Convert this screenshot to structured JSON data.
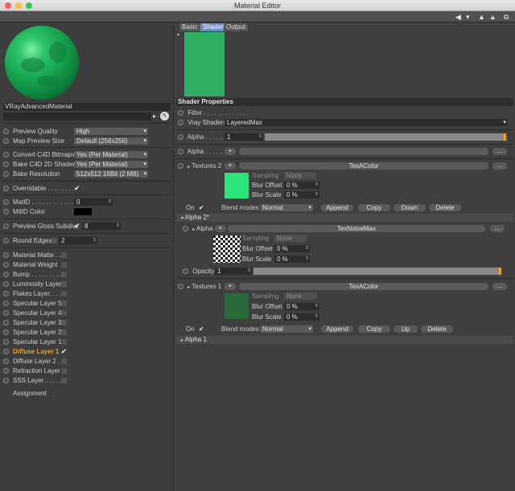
{
  "window": {
    "title": "Material Editor"
  },
  "colors": {
    "diffuse_highlight": "#f0a020",
    "preview_green": "#2fae63",
    "bright_green": "#2ee37a",
    "dark_green": "#2a6a3a"
  },
  "left": {
    "material_name": "VRayAdvancedMaterial",
    "settings": [
      {
        "label": "Preview Quality",
        "value": "High"
      },
      {
        "label": "Map Preview Size",
        "value": "Default (256x256)"
      },
      {
        "label": "Convert C4D Bitmaps",
        "value": "Yes (Per Material)"
      },
      {
        "label": "Bake C4D 2D Shaders",
        "value": "Yes (Per Material)"
      },
      {
        "label": "Bake Resolution",
        "value": "512x512   16Bit  (2 Mill)"
      }
    ],
    "overridable_label": "Overridable . . . . . . . .",
    "matid_label": "MatID . . . . . . . . . . . . .",
    "matid_value": "0",
    "matid_color_label": "MtlID Color",
    "gloss_label": "Preview Gloss Subdivs",
    "gloss_value": "8",
    "round_label": "Round Edges",
    "round_value": "2",
    "layers": [
      {
        "label": "Material Matte . . .",
        "checked": false,
        "active": false
      },
      {
        "label": "Material Weight",
        "checked": false,
        "active": false
      },
      {
        "label": "Bump . . . . . . . . . .",
        "checked": false,
        "active": false
      },
      {
        "label": "Luminosity Layer",
        "checked": false,
        "active": false
      },
      {
        "label": "Flakes Layer. . . . .",
        "checked": false,
        "active": false
      },
      {
        "label": "Specular Layer 5",
        "checked": false,
        "active": false
      },
      {
        "label": "Specular Layer 4",
        "checked": false,
        "active": false
      },
      {
        "label": "Specular Layer 3",
        "checked": false,
        "active": false
      },
      {
        "label": "Specular Layer 2",
        "checked": false,
        "active": false
      },
      {
        "label": "Specular Layer 1",
        "checked": false,
        "active": false
      },
      {
        "label": "Diffuse Layer 1 .",
        "checked": true,
        "active": true
      },
      {
        "label": "Diffuse Layer 2 . .",
        "checked": false,
        "active": false
      },
      {
        "label": "Refraction Layer",
        "checked": false,
        "active": false
      },
      {
        "label": "SSS Layer . . . . .",
        "checked": false,
        "active": false
      }
    ],
    "assignment_label": "Assignment"
  },
  "right": {
    "tabs": [
      "Basic",
      "Shader",
      "Output"
    ],
    "section_title": "Shader Properties",
    "filter_label": "Filter . . . . . . . . . . . . .",
    "vray_shaders_label": "Vray Shaders",
    "vray_shaders_value": "LayeredMax",
    "alpha_label": "Alpha . . . . .",
    "alpha_value": "1",
    "alpha2_label": "Alpha . . . . .",
    "btn_dots": "...",
    "textures2_label": "Textures 2",
    "tex_a_name": "TexAColor",
    "sampling_label": "Sampling",
    "sampling_value": "None",
    "blur_offset_label": "Blur Offset",
    "blur_offset_value": "0 %",
    "blur_scale_label": "Blur Scale",
    "blur_scale_value": "0 %",
    "on_label": "On",
    "blend_label": "Blend modes",
    "blend_value": "Normal",
    "buttons_a": [
      "Append",
      "Copy",
      "Down",
      "Delete"
    ],
    "alpha2_section": "Alpha 2*",
    "alpha_inner_label": "Alpha",
    "noise_name": "TexNoiseMax",
    "opacity_label": "Opacity",
    "opacity_value": "1",
    "textures1_label": "Textures 1",
    "tex_b_name": "TexAColor",
    "buttons_b": [
      "Append",
      "Copy",
      "Up",
      "Delete"
    ],
    "alpha1_section": "Alpha 1"
  }
}
